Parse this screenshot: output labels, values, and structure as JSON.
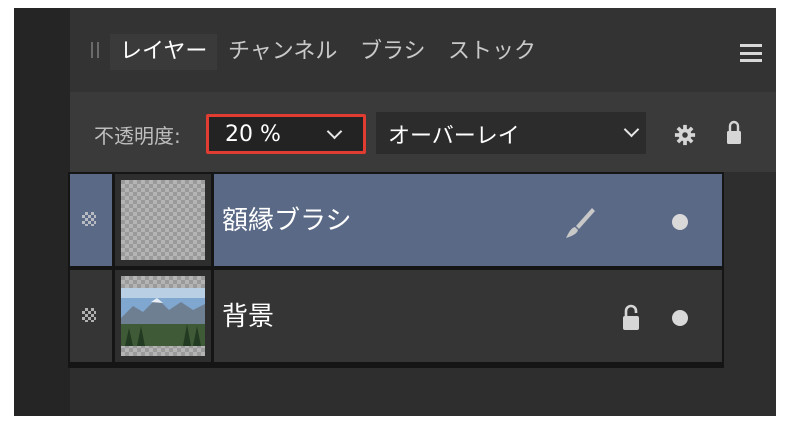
{
  "tabs": [
    {
      "label": "レイヤー",
      "active": true
    },
    {
      "label": "チャンネル",
      "active": false
    },
    {
      "label": "ブラシ",
      "active": false
    },
    {
      "label": "ストック",
      "active": false
    }
  ],
  "options": {
    "opacity_label": "不透明度:",
    "opacity_value": "20 %",
    "blend_mode": "オーバーレイ"
  },
  "layers": [
    {
      "name": "額縁ブラシ",
      "selected": true
    },
    {
      "name": "背景",
      "selected": false
    }
  ],
  "icons": [
    "panel-grip-icon",
    "menu-icon",
    "chevron-down-icon",
    "gear-icon",
    "lock-icon",
    "brush-icon",
    "visibility-dot-icon",
    "dither-icon"
  ],
  "colors": {
    "highlight_border": "#e03c31",
    "selected_layer": "#5a6a86"
  }
}
